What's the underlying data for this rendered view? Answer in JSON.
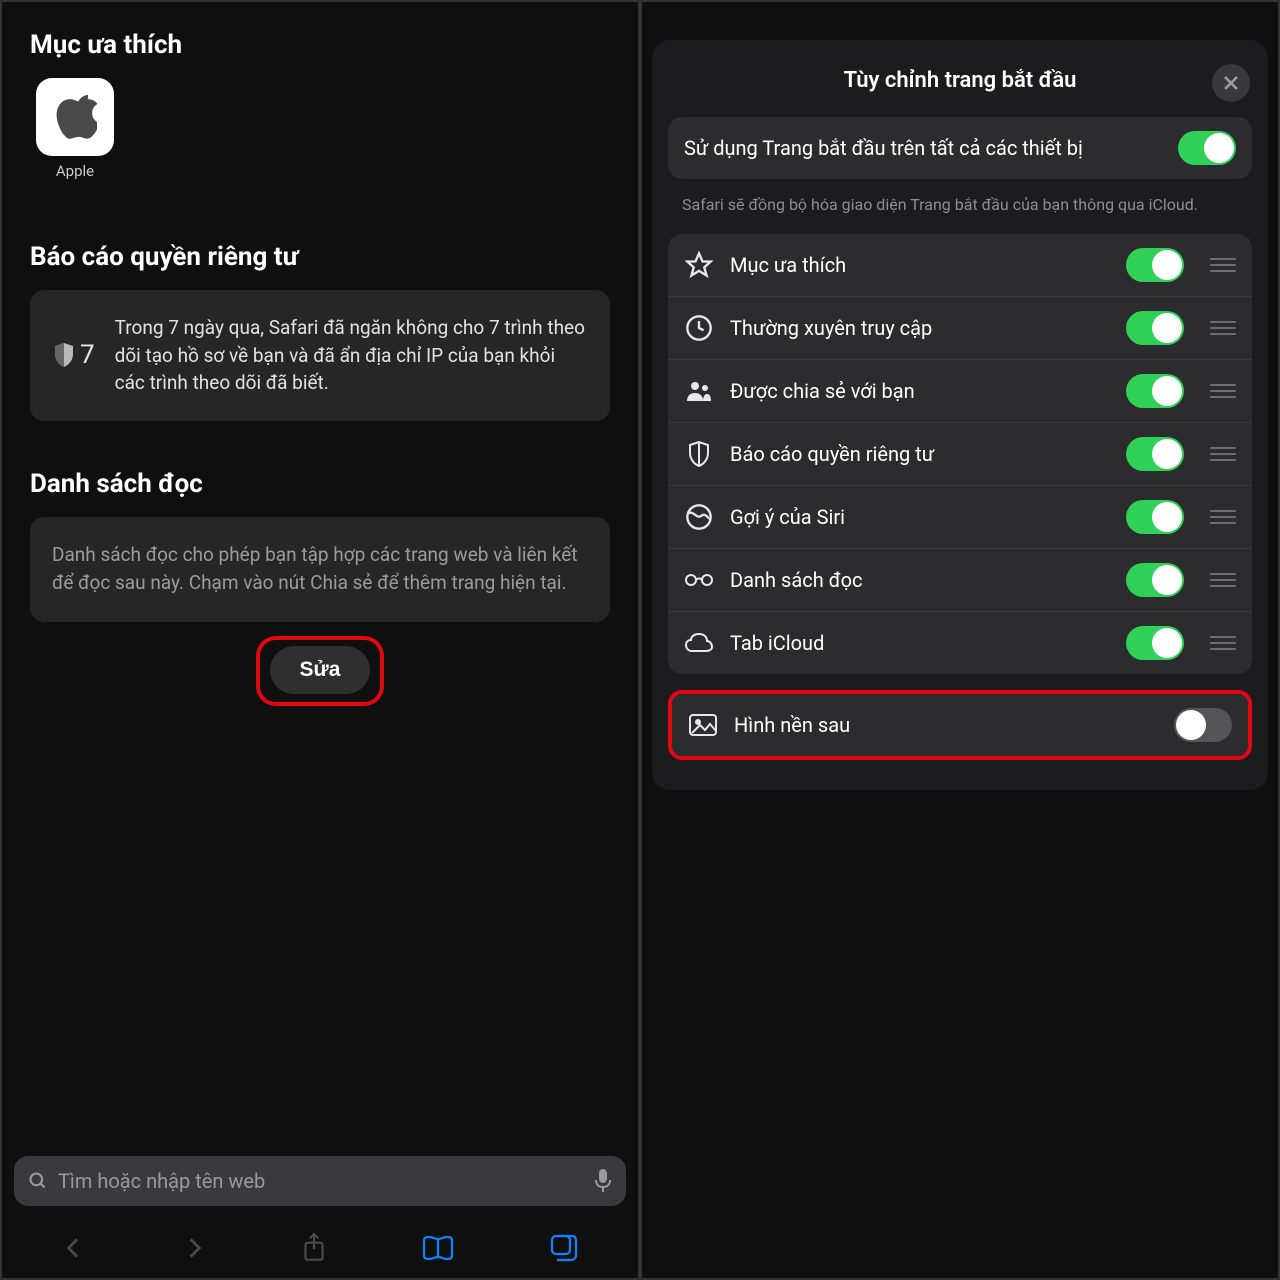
{
  "left": {
    "favorites": {
      "title": "Mục ưa thích",
      "items": [
        {
          "label": "Apple"
        }
      ]
    },
    "privacy": {
      "title": "Báo cáo quyền riêng tư",
      "count": "7",
      "text": "Trong 7 ngày qua, Safari đã ngăn không cho 7 trình theo dõi tạo hồ sơ về bạn và đã ẩn địa chỉ IP của bạn khỏi các trình theo dõi đã biết."
    },
    "reading": {
      "title": "Danh sách đọc",
      "text": "Danh sách đọc cho phép bạn tập hợp các trang web và liên kết để đọc sau này. Chạm vào nút Chia sẻ để thêm trang hiện tại."
    },
    "edit_button": "Sửa",
    "search_placeholder": "Tìm hoặc nhập tên web"
  },
  "right": {
    "sheet_title": "Tùy chỉnh trang bắt đầu",
    "sync": {
      "label": "Sử dụng Trang bắt đầu trên tất cả các thiết bị",
      "on": true
    },
    "sync_footer": "Safari sẽ đồng bộ hóa giao diện Trang bắt đầu của bạn thông qua iCloud.",
    "items": [
      {
        "icon": "star",
        "label": "Mục ưa thích",
        "on": true
      },
      {
        "icon": "clock",
        "label": "Thường xuyên truy cập",
        "on": true
      },
      {
        "icon": "people",
        "label": "Được chia sẻ với bạn",
        "on": true
      },
      {
        "icon": "shield",
        "label": "Báo cáo quyền riêng tư",
        "on": true
      },
      {
        "icon": "siri",
        "label": "Gợi ý của Siri",
        "on": true
      },
      {
        "icon": "glasses",
        "label": "Danh sách đọc",
        "on": true
      },
      {
        "icon": "cloud",
        "label": "Tab iCloud",
        "on": true
      }
    ],
    "background": {
      "label": "Hình nền sau",
      "on": false
    }
  }
}
